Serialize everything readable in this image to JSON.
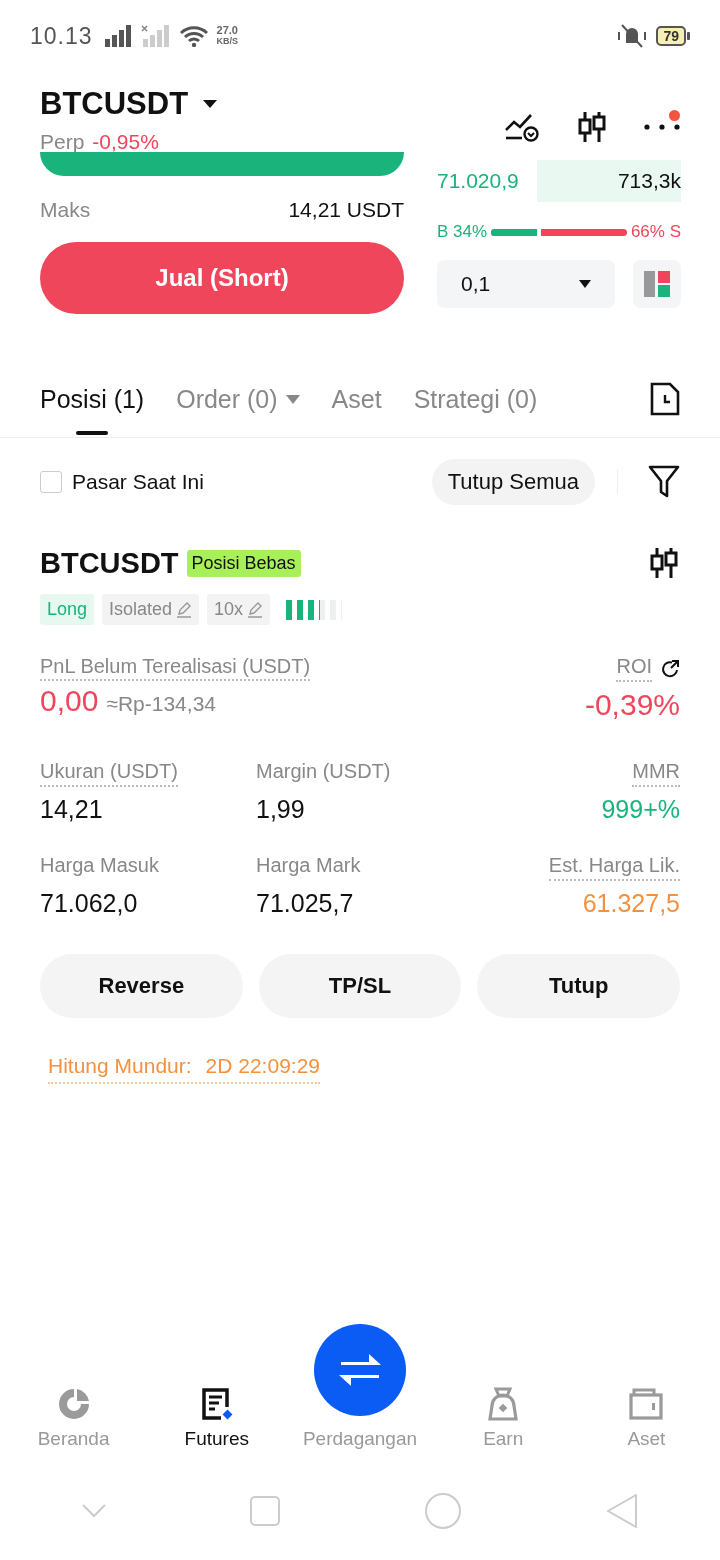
{
  "status_bar": {
    "time": "10.13",
    "speed_value": "27.0",
    "speed_unit": "KB/S",
    "battery": "79"
  },
  "header": {
    "symbol": "BTCUSDT",
    "subtitle": "Perp",
    "change": "-0,95%",
    "has_notification": true
  },
  "order_form": {
    "max_label": "Maks",
    "max_value": "14,21 USDT",
    "sell_button": "Jual (Short)"
  },
  "order_book": {
    "price": "71.020,9",
    "volume": "713,3k",
    "buy_ratio": "B 34%",
    "sell_ratio": "66% S",
    "level": 0.34,
    "precision": "0,1"
  },
  "tabs": [
    {
      "label": "Posisi (1)",
      "selected": true,
      "dropdown": false
    },
    {
      "label": "Order (0)",
      "selected": false,
      "dropdown": true
    },
    {
      "label": "Aset",
      "selected": false,
      "dropdown": false
    },
    {
      "label": "Strategi (0)",
      "selected": false,
      "dropdown": false
    }
  ],
  "filter": {
    "label": "Pasar Saat Ini",
    "checked": false,
    "close_all": "Tutup Semua"
  },
  "position": {
    "symbol": "BTCUSDT",
    "badge": "Posisi Bebas",
    "tags": [
      {
        "label": "Long",
        "kind": "side"
      },
      {
        "label": "Isolated",
        "kind": "editable"
      },
      {
        "label": "10x",
        "kind": "editable"
      }
    ],
    "risk": {
      "level": 0.6
    },
    "pnl_label": "PnL Belum Terealisasi (USDT)",
    "pnl_value": "0,00",
    "pnl_approx": "≈Rp-134,34",
    "roi_label": "ROI",
    "roi_value": "-0,39%",
    "stats": [
      {
        "label": "Ukuran (USDT)",
        "value": "14,21",
        "dotted": true,
        "color": "#111111"
      },
      {
        "label": "Margin (USDT)",
        "value": "1,99",
        "dotted": false,
        "color": "#111111"
      },
      {
        "label": "MMR",
        "value": "999+%",
        "dotted": true,
        "color": "#19b37b"
      },
      {
        "label": "Harga Masuk",
        "value": "71.062,0",
        "dotted": false,
        "color": "#111111"
      },
      {
        "label": "Harga Mark",
        "value": "71.025,7",
        "dotted": false,
        "color": "#111111"
      },
      {
        "label": "Est. Harga Lik.",
        "value": "61.327,5",
        "dotted": true,
        "color": "#f5913e"
      }
    ],
    "actions": [
      "Reverse",
      "TP/SL",
      "Tutup"
    ],
    "countdown_label": "Hitung Mundur:",
    "countdown_value": "2D 22:09:29"
  },
  "bottom_nav": [
    {
      "label": "Beranda",
      "kind": "home",
      "selected": false
    },
    {
      "label": "Futures",
      "kind": "futures",
      "selected": true
    },
    {
      "label": "Perdagangan",
      "kind": "trade",
      "selected": false
    },
    {
      "label": "Earn",
      "kind": "earn",
      "selected": false
    },
    {
      "label": "Aset",
      "kind": "wallet",
      "selected": false
    }
  ]
}
